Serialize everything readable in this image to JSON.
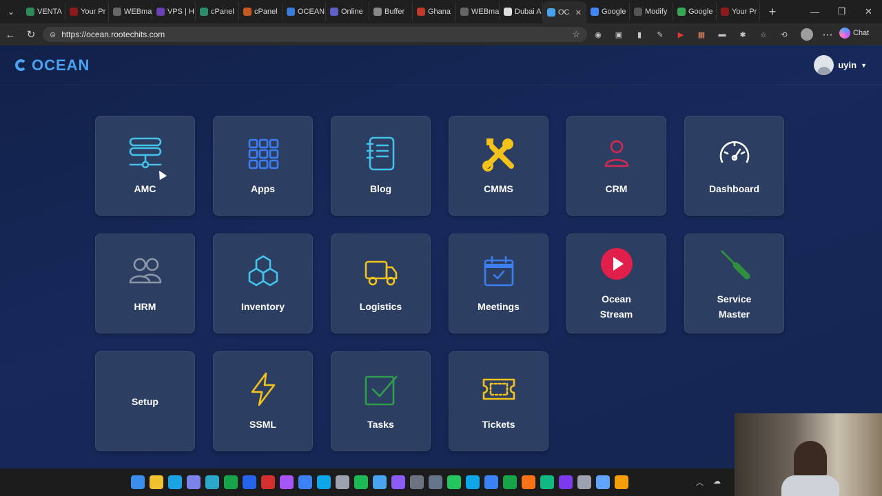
{
  "browser": {
    "tabs": [
      {
        "label": "VENTA",
        "color": "#2e8b57"
      },
      {
        "label": "Your Pr",
        "color": "#8b1a1a"
      },
      {
        "label": "WEBma",
        "color": "#666666"
      },
      {
        "label": "VPS | H",
        "color": "#6a3fb5"
      },
      {
        "label": "cPanel",
        "color": "#2a8c6a"
      },
      {
        "label": "cPanel",
        "color": "#c45a1d"
      },
      {
        "label": "OCEAN",
        "color": "#3a7bd5"
      },
      {
        "label": "Online",
        "color": "#5b5fc7"
      },
      {
        "label": "Buffer",
        "color": "#888888"
      },
      {
        "label": "Ghana",
        "color": "#c0392b"
      },
      {
        "label": "WEBma",
        "color": "#666666"
      },
      {
        "label": "Dubai A",
        "color": "#dddddd"
      },
      {
        "label": "OC",
        "color": "#4aa3f0",
        "active": true
      },
      {
        "label": "Google",
        "color": "#4285f4"
      },
      {
        "label": "Modify",
        "color": "#555555"
      },
      {
        "label": "Google",
        "color": "#34a853"
      },
      {
        "label": "Your Pr",
        "color": "#8b1a1a"
      }
    ],
    "url": "https://ocean.rootechits.com",
    "chat_label": "Chat"
  },
  "app": {
    "brand": "OCEAN",
    "username": "uyin",
    "modules": [
      {
        "label": "AMC",
        "icon": "server-network-icon",
        "color": "#45c2ea"
      },
      {
        "label": "Apps",
        "icon": "apps-grid-icon",
        "color": "#3d7ef0"
      },
      {
        "label": "Blog",
        "icon": "notebook-icon",
        "color": "#45c2ea"
      },
      {
        "label": "CMMS",
        "icon": "tools-icon",
        "color": "#f3c21b"
      },
      {
        "label": "CRM",
        "icon": "user-icon",
        "color": "#d9284f"
      },
      {
        "label": "Dashboard",
        "icon": "speedometer-icon",
        "color": "#ffffff"
      },
      {
        "label": "HRM",
        "icon": "users-icon",
        "color": "#8d97a8"
      },
      {
        "label": "Inventory",
        "icon": "cubes-icon",
        "color": "#45c2ea"
      },
      {
        "label": "Logistics",
        "icon": "truck-icon",
        "color": "#f3c21b"
      },
      {
        "label": "Meetings",
        "icon": "calendar-check-icon",
        "color": "#3d7ef0"
      },
      {
        "label": "Ocean Stream",
        "icon": "play-circle-icon",
        "color": "#e0204a"
      },
      {
        "label": "Service Master",
        "icon": "screwdriver-icon",
        "color": "#2f8f3e"
      },
      {
        "label": "Setup",
        "icon": "",
        "color": ""
      },
      {
        "label": "SSML",
        "icon": "lightning-icon",
        "color": "#f3c21b"
      },
      {
        "label": "Tasks",
        "icon": "checkbox-icon",
        "color": "#2f9e4a"
      },
      {
        "label": "Tickets",
        "icon": "ticket-icon",
        "color": "#f3c21b"
      }
    ]
  }
}
